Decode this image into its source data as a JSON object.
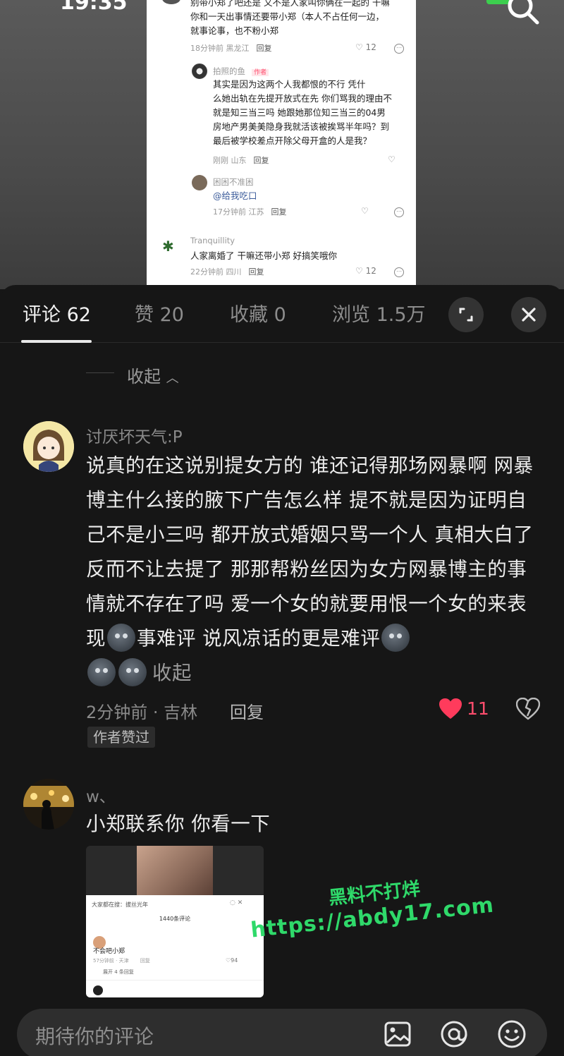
{
  "status": {
    "time": "19:35",
    "signal": "▲"
  },
  "shot": {
    "top_text_1": "别带小郑了吧还是 又不是人家叫你俩在一起的 干嘛",
    "top_text_2": "你和一天出事情还要带小郑（本人不占任何一边，",
    "top_text_3": "就事论事，也不粉小郑",
    "top_meta": "18分钟前 黑龙江",
    "top_reply": "回复",
    "top_likes": "12",
    "c1_name": "拍照的鱼",
    "c1_badge": "作者",
    "c1_lines": [
      "其实是因为这两个人我都恨的不行 凭什",
      "么她出轨在先提开放式在先 你们骂我的理由不",
      "就是知三当三吗 她跟她那位知三当三的04男",
      "房地产男美美隐身我就活该被挨骂半年吗？到",
      "最后被学校差点开除父母开盒的人是我？"
    ],
    "c1_meta": "刚刚 山东",
    "c1_reply": "回复",
    "c2_name": "困困不准困",
    "c2_text": "@给我吃口",
    "c2_meta": "17分钟前 江苏",
    "c2_reply": "回复",
    "c3_name": "Tranquillity",
    "c3_text": "人家离婚了 干嘛还带小郑 好搞笑哦你",
    "c3_meta": "22分钟前 四川",
    "c3_reply": "回复",
    "c3_likes": "12"
  },
  "tabs": [
    {
      "label": "评论 62",
      "active": true
    },
    {
      "label": "赞 20"
    },
    {
      "label": "收藏 0"
    },
    {
      "label": "浏览 1.5万"
    }
  ],
  "collapse_label": "收起",
  "comments": [
    {
      "user": "讨厌坏天气:P",
      "text_parts": [
        "说真的在这说别提女方的 谁还记得那场网暴啊 网暴博主什么接的腋下广告怎么样 提不就是因为证明自己不是小三吗 都开放式婚姻只骂一个人 真相大白了反而不让去提了 那那帮粉丝因为女方网暴博主的事情就不存在了吗 爱一个女的就要用恨一个女的来表现",
        "事难评 说风凉话的更是难评"
      ],
      "fold": "收起",
      "meta": "2分钟前 · 吉林",
      "reply": "回复",
      "likes": "11",
      "badge": "作者赞过"
    },
    {
      "user": "w、",
      "text": "小郑联系你 你看一下",
      "card": {
        "header": "大家都在搜：拔丝光年",
        "count": "1440条评论",
        "comment": "不会吧小郑",
        "meta": "57分钟前 · 天津",
        "reply": "回复",
        "likes": "94",
        "expand": "展开 4 条回复"
      }
    }
  ],
  "watermark": {
    "line1": "黑料不打烊",
    "line2": "https://abdy17.com"
  },
  "input": {
    "placeholder": "期待你的评论"
  },
  "colors": {
    "like": "#ff4d6d",
    "sheet": "#161616",
    "watermark": "#2fd96a"
  }
}
